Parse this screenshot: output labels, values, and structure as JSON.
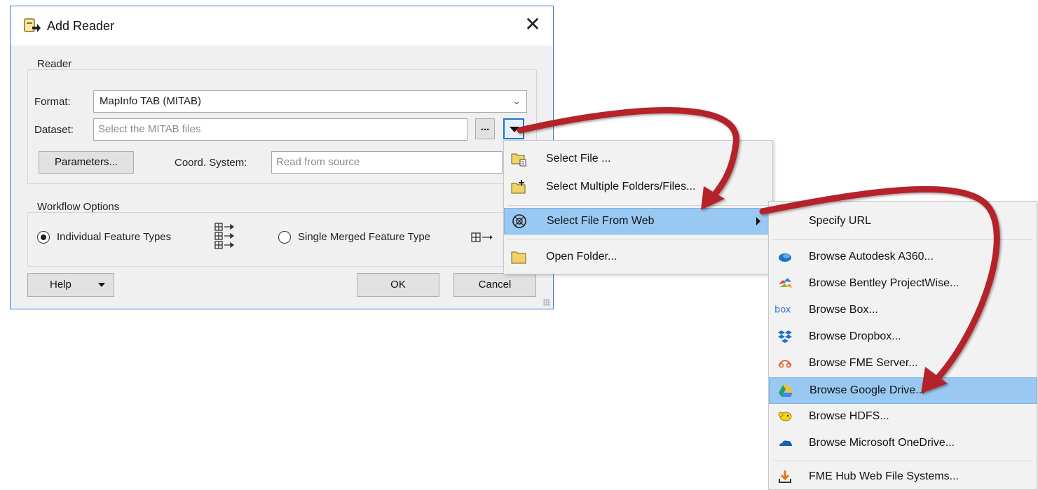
{
  "dialog": {
    "title": "Add Reader",
    "close_glyph": "✕",
    "reader_group": {
      "label": "Reader",
      "format_label": "Format:",
      "format_value": "MapInfo TAB (MITAB)",
      "dataset_label": "Dataset:",
      "dataset_placeholder": "Select the MITAB files",
      "ellipsis_label": "...",
      "parameters_label": "Parameters...",
      "coord_label": "Coord. System:",
      "coord_placeholder": "Read from source"
    },
    "workflow_group": {
      "label": "Workflow Options",
      "option_individual": "Individual Feature Types",
      "option_merged": "Single Merged Feature Type",
      "selected": "Individual Feature Types"
    },
    "buttons": {
      "help": "Help",
      "ok": "OK",
      "cancel": "Cancel"
    }
  },
  "dataset_menu": {
    "items": [
      {
        "label": "Select File ...",
        "icon": "folder-file-icon"
      },
      {
        "label": "Select Multiple Folders/Files...",
        "icon": "folder-add-icon"
      },
      {
        "label": "Select File From Web",
        "icon": "web-icon",
        "highlighted": true,
        "has_submenu": true
      },
      {
        "label": "Open Folder...",
        "icon": "folder-icon"
      }
    ]
  },
  "web_menu": {
    "items": [
      {
        "label": "Specify URL",
        "icon": ""
      },
      {
        "label": "Browse Autodesk A360...",
        "icon": "autodesk-icon"
      },
      {
        "label": "Browse Bentley ProjectWise...",
        "icon": "bentley-icon"
      },
      {
        "label": "Browse Box...",
        "icon": "box-icon",
        "icon_text": "box"
      },
      {
        "label": "Browse Dropbox...",
        "icon": "dropbox-icon"
      },
      {
        "label": "Browse FME Server...",
        "icon": "fme-server-icon"
      },
      {
        "label": "Browse Google Drive...",
        "icon": "google-drive-icon",
        "highlighted": true
      },
      {
        "label": "Browse HDFS...",
        "icon": "hdfs-icon"
      },
      {
        "label": "Browse Microsoft OneDrive...",
        "icon": "onedrive-icon"
      },
      {
        "label": "FME Hub Web File Systems...",
        "icon": "fme-hub-icon"
      }
    ]
  },
  "colors": {
    "highlight": "#99c9f2",
    "arrow": "#b5202a",
    "dialog_border": "#2a7fd4"
  }
}
